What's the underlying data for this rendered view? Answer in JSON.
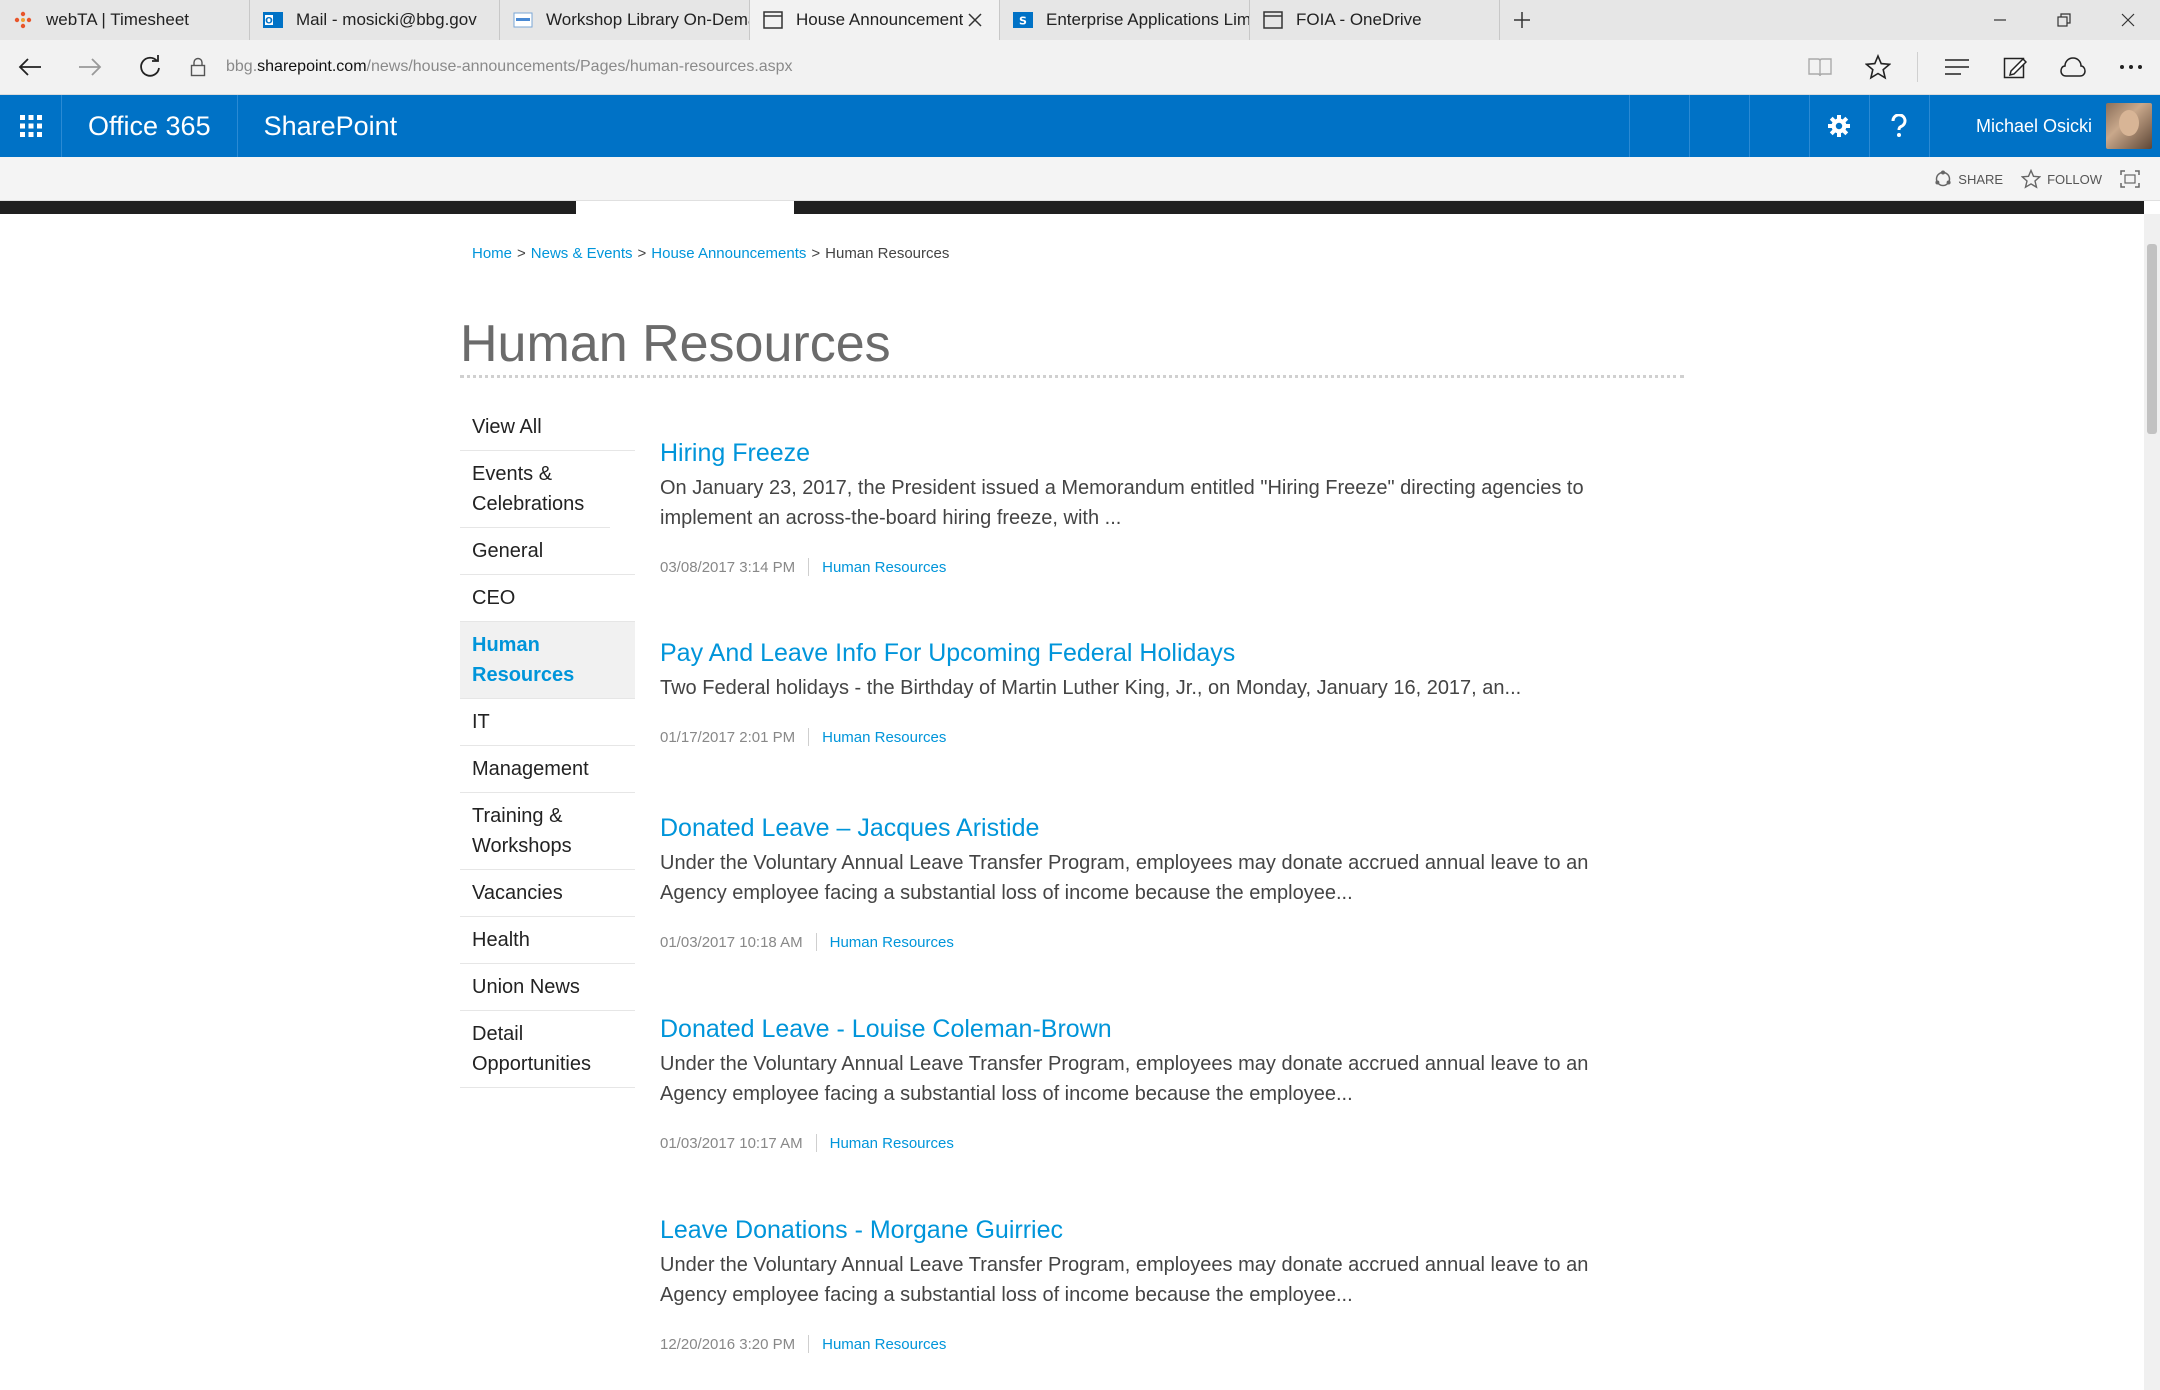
{
  "browser": {
    "tabs": [
      {
        "label": "webTA | Timesheet",
        "icon": "webta-icon",
        "active": false
      },
      {
        "label": "Mail - mosicki@bbg.gov",
        "icon": "outlook-icon",
        "active": false
      },
      {
        "label": "Workshop Library On-Dema",
        "icon": "onedrive-doc-icon",
        "active": false
      },
      {
        "label": "House Announcements",
        "icon": "page-icon",
        "active": true
      },
      {
        "label": "Enterprise Applications Limi",
        "icon": "sharepoint-icon",
        "active": false
      },
      {
        "label": "FOIA - OneDrive",
        "icon": "page-icon",
        "active": false
      }
    ],
    "url_prefix": "bbg.",
    "url_host": "sharepoint.com",
    "url_path": "/news/house-announcements/Pages/human-resources.aspx"
  },
  "suitebar": {
    "brand": "Office 365",
    "app": "SharePoint",
    "user_name": "Michael Osicki"
  },
  "ribbon": {
    "share_label": "SHARE",
    "follow_label": "FOLLOW"
  },
  "breadcrumb": {
    "items": [
      "Home",
      "News & Events",
      "House Announcements"
    ],
    "current": "Human Resources",
    "separator": ">"
  },
  "page": {
    "title": "Human Resources"
  },
  "left_nav": [
    {
      "label": "View All"
    },
    {
      "label": "Events & Celebrations"
    },
    {
      "label": "General"
    },
    {
      "label": "CEO"
    },
    {
      "label": "Human Resources",
      "active": true
    },
    {
      "label": "IT"
    },
    {
      "label": "Management"
    },
    {
      "label": "Training & Workshops"
    },
    {
      "label": "Vacancies"
    },
    {
      "label": "Health"
    },
    {
      "label": "Union News"
    },
    {
      "label": "Detail Opportunities"
    }
  ],
  "articles": [
    {
      "title": "Hiring Freeze",
      "summary": "On January 23, 2017, the President issued a Memorandum entitled \"Hiring Freeze\" directing agencies to implement an across-the-board hiring freeze, with ...",
      "date": "03/08/2017 3:14 PM",
      "category": "Human Resources"
    },
    {
      "title": "Pay And Leave Info For Upcoming Federal Holidays",
      "summary": "Two Federal holidays - the Birthday of Martin Luther King, Jr., on Monday, January 16, 2017, an...",
      "date": "01/17/2017 2:01 PM",
      "category": "Human Resources"
    },
    {
      "title": "Donated Leave – Jacques Aristide",
      "summary": "Under the Voluntary Annual Leave Transfer Program, employees may donate accrued annual leave to an Agency employee facing a substantial loss of income because the employee...",
      "date": "01/03/2017 10:18 AM",
      "category": "Human Resources"
    },
    {
      "title": "Donated Leave - Louise Coleman-Brown",
      "summary": "Under the Voluntary Annual Leave Transfer Program, employees may donate accrued annual leave to an Agency employee facing a substantial loss of income because the employee...",
      "date": "01/03/2017 10:17 AM",
      "category": "Human Resources"
    },
    {
      "title": "Leave Donations - Morgane Guirriec",
      "summary": "Under the Voluntary Annual Leave Transfer Program, employees may donate accrued annual leave to an Agency employee facing a substantial loss of income because the employee...",
      "date": "12/20/2016 3:20 PM",
      "category": "Human Resources"
    }
  ],
  "colors": {
    "suite_blue": "#0072c6",
    "link_blue": "#0095da",
    "title_gray": "#6b6b6b"
  }
}
